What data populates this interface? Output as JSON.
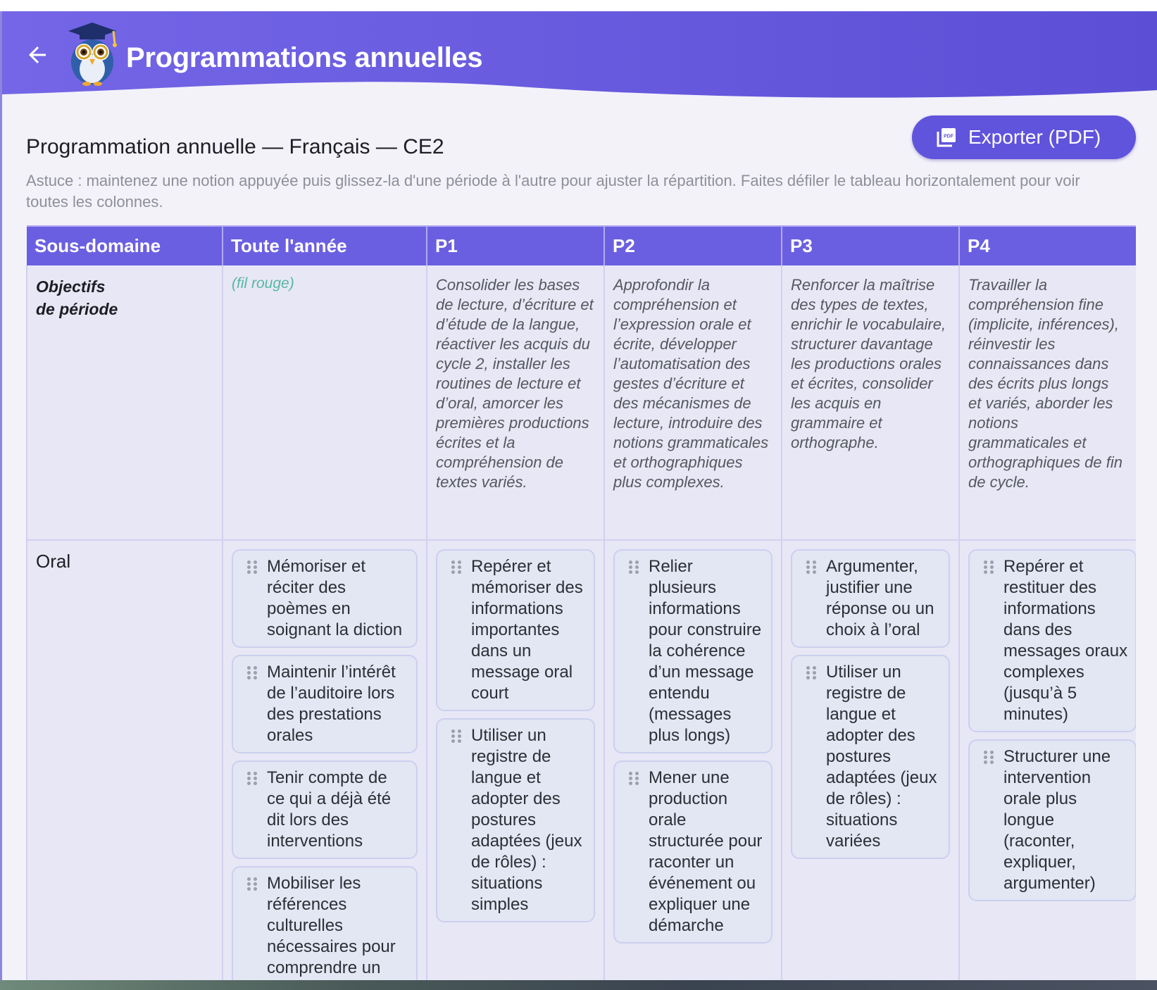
{
  "header": {
    "title": "Programmations annuelles",
    "back_icon": "arrow-left-icon",
    "logo_icon": "owl-graduate-icon",
    "gradient_start": "#7466e6",
    "gradient_end": "#5c4fd6"
  },
  "page": {
    "title": "Programmation annuelle — Français — CE2",
    "export_label": "Exporter (PDF)",
    "export_icon": "pdf-icon",
    "hint": "Astuce : maintenez une notion appuyée puis glissez-la d'une période à l'autre pour ajuster la répartition. Faites défiler le tableau horizontalement pour voir toutes les colonnes."
  },
  "table": {
    "headers": [
      "Sous-domaine",
      "Toute l'année",
      "P1",
      "P2",
      "P3",
      "P4"
    ],
    "objectives_row": {
      "label_line1": "Objectifs",
      "label_line2": "de période",
      "all_year": "(fil rouge)",
      "periods": [
        "Consolider les bases de lecture, d’écriture et d’étude de la langue, réactiver les acquis du cycle 2, installer les routines de lecture et d’oral, amorcer les premières productions écrites et la compréhension de textes variés.",
        "Approfondir la compréhension et l’expression orale et écrite, développer l’automatisation des gestes d’écriture et des mécanismes de lecture, introduire des notions grammaticales et orthographiques plus complexes.",
        "Renforcer la maîtrise des types de textes, enrichir le vocabulaire, structurer davantage les productions orales et écrites, consolider les acquis en grammaire et orthographe.",
        "Travailler la compréhension fine (implicite, inférences), réinvestir les connaissances dans des écrits plus longs et variés, aborder les notions grammaticales et orthographiques de fin de cycle."
      ]
    },
    "oral_row": {
      "label": "Oral",
      "all_year": [
        "Mémoriser et réciter des poèmes en soignant la diction",
        "Maintenir l’intérêt de l’auditoire lors des prestations orales",
        "Tenir compte de ce qui a déjà été dit lors des interventions",
        "Mobiliser les références culturelles nécessaires pour comprendre un message ou un texte"
      ],
      "p1": [
        "Repérer et mémoriser des informations importantes dans un message oral court",
        "Utiliser un registre de langue et adopter des postures adaptées (jeux de rôles) : situations simples"
      ],
      "p2": [
        "Relier plusieurs informations pour construire la cohérence d’un message entendu (messages plus longs)",
        "Mener une production orale structurée pour raconter un événement ou expliquer une démarche"
      ],
      "p3": [
        "Argumenter, justifier une réponse ou un choix à l’oral",
        "Utiliser un registre de langue et adopter des postures adaptées (jeux de rôles) : situations variées"
      ],
      "p4": [
        "Repérer et restituer des informations dans des messages oraux complexes (jusqu’à 5 minutes)",
        "Structurer une intervention orale plus longue (raconter, expliquer, argumenter)"
      ],
      "card_grip_icon": "drag-handle-icon"
    }
  }
}
